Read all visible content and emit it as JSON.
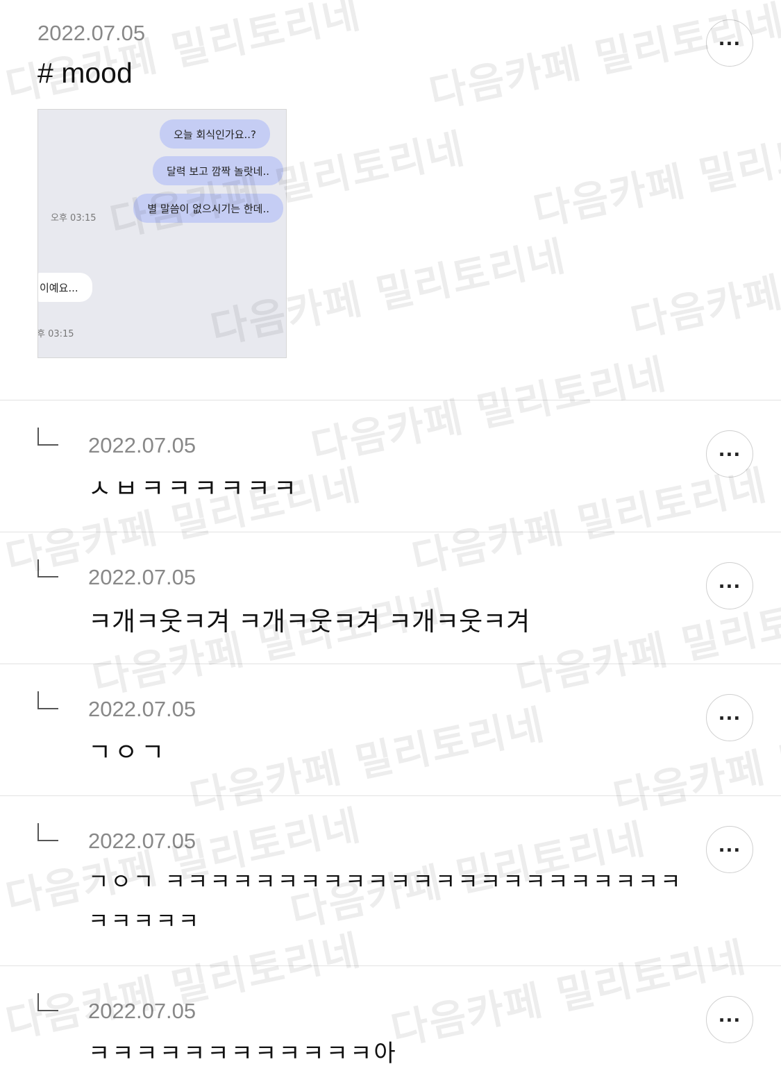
{
  "post": {
    "date": "2022.07.05",
    "title": "# mood",
    "more_icon": "more-dots-icon",
    "image": {
      "bubbles": [
        "오늘 회식인가요..?",
        "달력 보고 깜짝 놀랏네..",
        "별 말씀이 없으시기는 한데.."
      ],
      "time_right": "오후 03:15",
      "reply_bubble": "이예요...",
      "time_left": "후 03:15"
    }
  },
  "comments": [
    {
      "date": "2022.07.05",
      "text": "ㅅㅂㅋㅋㅋㅋㅋㅋ",
      "line2": ""
    },
    {
      "date": "2022.07.05",
      "text": "ㅋ개ㅋ웃ㅋ겨 ㅋ개ㅋ웃ㅋ겨 ㅋ개ㅋ웃ㅋ겨",
      "line2": ""
    },
    {
      "date": "2022.07.05",
      "text": "ㄱㅇㄱ",
      "line2": ""
    },
    {
      "date": "2022.07.05",
      "text": "ㄱㅇㄱ ㅋㅋㅋㅋㅋㅋㅋㅋㅋㅋㅋㅋㅋㅋㅋㅋㅋㅋㅋㅋㅋㅋㅋ",
      "line2": "ㅋㅋㅋㅋㅋ"
    },
    {
      "date": "2022.07.05",
      "text": "ㅋㅋㅋㅋㅋㅋㅋㅋㅋㅋㅋㅋ아",
      "line2": ""
    }
  ],
  "watermark": "다음카페 밀리토리네"
}
